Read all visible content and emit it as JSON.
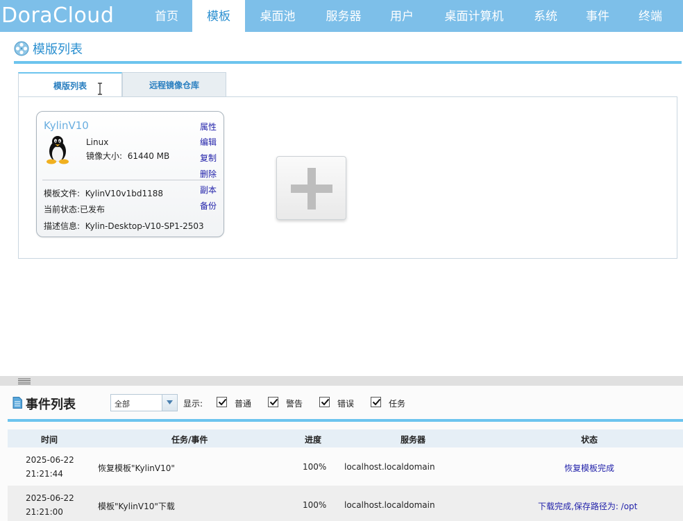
{
  "app": {
    "logo": "DoraCloud"
  },
  "nav": {
    "items": [
      {
        "label": "首页"
      },
      {
        "label": "模板"
      },
      {
        "label": "桌面池"
      },
      {
        "label": "服务器"
      },
      {
        "label": "用户"
      },
      {
        "label": "桌面计算机"
      },
      {
        "label": "系统"
      },
      {
        "label": "事件"
      },
      {
        "label": "终端"
      }
    ],
    "active": "模板"
  },
  "templates": {
    "section_title": "模版列表",
    "tabs": [
      {
        "label": "模版列表",
        "active": true
      },
      {
        "label": "远程镜像仓库",
        "active": false
      }
    ],
    "cards": [
      {
        "name": "KylinV10",
        "os": "Linux",
        "size_label": "镜像大小:",
        "size_value": "61440 MB",
        "file_label": "模板文件:",
        "file_value": "KylinV10v1bd1188",
        "state_label": "当前状态:",
        "state_value": "已发布",
        "desc_label": "描述信息:",
        "desc_value": "Kylin-Desktop-V10-SP1-2503",
        "actions": [
          "属性",
          "编辑",
          "复制",
          "删除",
          "副本",
          "备份"
        ]
      }
    ],
    "add_icon": "plus-icon"
  },
  "events": {
    "title": "事件列表",
    "filter": {
      "value": "全部"
    },
    "show_label": "显示:",
    "checkboxes": [
      {
        "label": "普通",
        "checked": true
      },
      {
        "label": "警告",
        "checked": true
      },
      {
        "label": "错误",
        "checked": true
      },
      {
        "label": "任务",
        "checked": true
      }
    ],
    "columns": [
      "时间",
      "任务/事件",
      "进度",
      "服务器",
      "状态"
    ],
    "rows": [
      {
        "time": "2025-06-22 21:21:44",
        "task": "恢复模板\"KylinV10\"",
        "progress": "100%",
        "server": "localhost.localdomain",
        "status": "恢复模板完成"
      },
      {
        "time": "2025-06-22 21:21:00",
        "task": "模板\"KylinV10\"下载",
        "progress": "100%",
        "server": "localhost.localdomain",
        "status": "下载完成,保存路径为: /opt"
      }
    ]
  },
  "colors": {
    "nav_bg": "#7dbfe9",
    "accent": "#2a8fd0",
    "rule": "#6cc4ee",
    "link": "#2222aa"
  }
}
